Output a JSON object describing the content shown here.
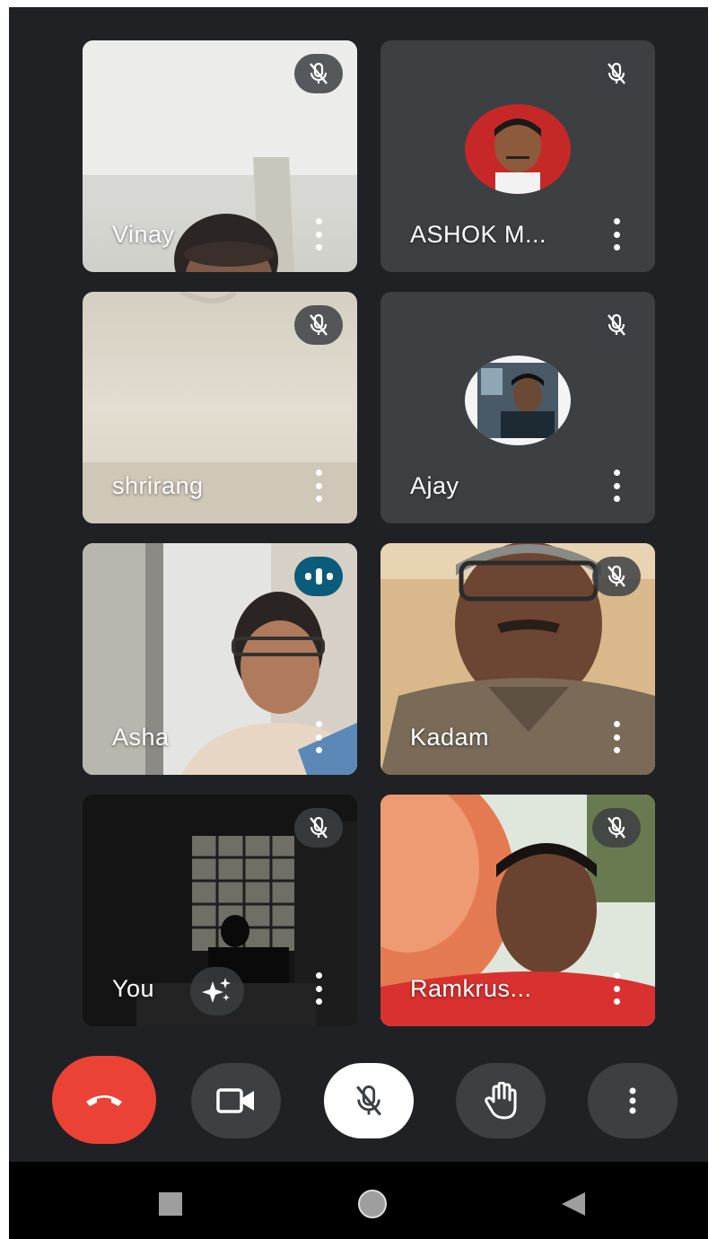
{
  "participants": [
    {
      "name": "Vinay",
      "status": "muted"
    },
    {
      "name": "ASHOK M...",
      "status": "muted"
    },
    {
      "name": "shrirang",
      "status": "muted"
    },
    {
      "name": "Ajay",
      "status": "muted"
    },
    {
      "name": "Asha",
      "status": "speaking"
    },
    {
      "name": "Kadam",
      "status": "muted"
    },
    {
      "name": "You",
      "status": "muted"
    },
    {
      "name": "Ramkrus...",
      "status": "muted"
    }
  ],
  "colors": {
    "background": "#202124",
    "tile": "#3c4043",
    "end_call": "#ea4335",
    "speaking_badge": "#0b5c7a",
    "mic_button": "#ffffff"
  },
  "controls": {
    "end_call_icon": "phone-hangup-icon",
    "camera_icon": "video-camera-icon",
    "mic_icon": "mic-off-icon",
    "raise_hand_icon": "raise-hand-icon",
    "more_icon": "more-vert-icon"
  },
  "navigation": {
    "recents_icon": "square-icon",
    "home_icon": "circle-icon",
    "back_icon": "triangle-back-icon"
  }
}
